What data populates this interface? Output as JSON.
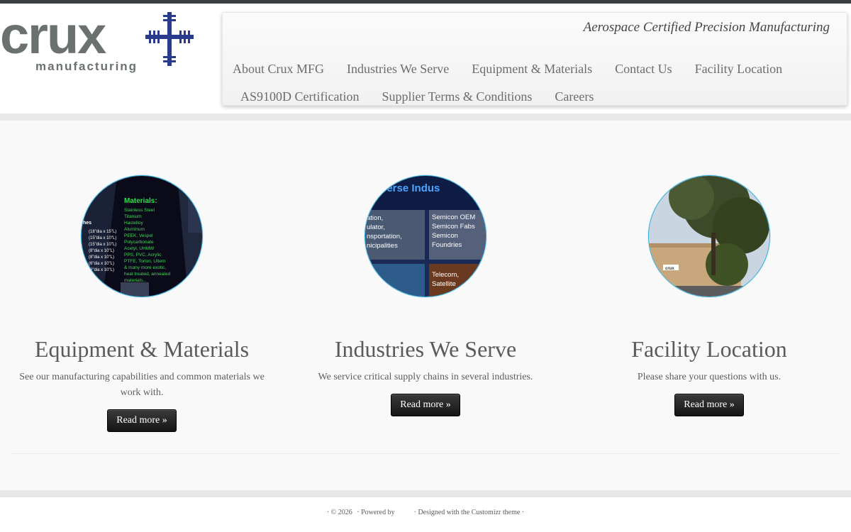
{
  "header": {
    "logo_text": "crux",
    "logo_subtext": "manufacturing",
    "tagline": "Aerospace Certified Precision Manufacturing",
    "nav_row1": [
      "About Crux MFG",
      "Industries We Serve",
      "Equipment & Materials",
      "Contact Us",
      "Facility Location"
    ],
    "nav_row2": [
      "AS9100D Certification",
      "Supplier Terms & Conditions",
      "Careers"
    ]
  },
  "features": [
    {
      "title": "Equipment & Materials",
      "text": "See our manufacturing capabilities and common materials we work with.",
      "button": "Read more »",
      "image": {
        "heading": "Materials:",
        "materials": [
          "Stainless Steel",
          "Titanium",
          "Hastelloy",
          "Aluminum",
          "PEEK, Vespel",
          "Polycarbonate",
          "Acetyl, UHMW",
          "PPS, PVC, Acrylic",
          "PTFE, Torlon, Ultem",
          "& many more exotic,",
          "heat treated, annealed",
          "materials..."
        ],
        "sizes_label": "hes",
        "sizes": [
          "(18\"dia x 15\"L)",
          "(15\"dia x 10\"L)",
          "(15\"dia x 10\"L)",
          "(8\"dia x 10\"L)",
          "(8\"dia x 10\"L)",
          "(6\"dia x 10\"L)",
          "(6\"dia x 10\"L)"
        ]
      }
    },
    {
      "title": "Industries We Serve",
      "text": "We service critical supply chains in several industries.",
      "button": "Read more »",
      "image": {
        "banner": "verse Indus",
        "left_lines": [
          "ation,",
          "ulator,",
          "nsportation,",
          "nicipalities"
        ],
        "right_lines": [
          "Semicon OEM",
          "Semicon Fabs",
          "Semicon",
          "Foundries"
        ],
        "bottom_lines": [
          "Telecom,",
          "Satellite"
        ]
      }
    },
    {
      "title": "Facility Location",
      "text": "Please share your questions with us.",
      "button": "Read more »",
      "image": {
        "sign": "crux"
      }
    }
  ],
  "footer": {
    "copyright": "· © 2026",
    "powered": "· Powered by",
    "designed": "· Designed with the Customizr theme ·"
  },
  "colors": {
    "accent_circle": "#29a6d8",
    "logo_gray": "#6b7070",
    "logo_blue": "#2a3a8c",
    "button_dark": "#1f1f1f"
  }
}
